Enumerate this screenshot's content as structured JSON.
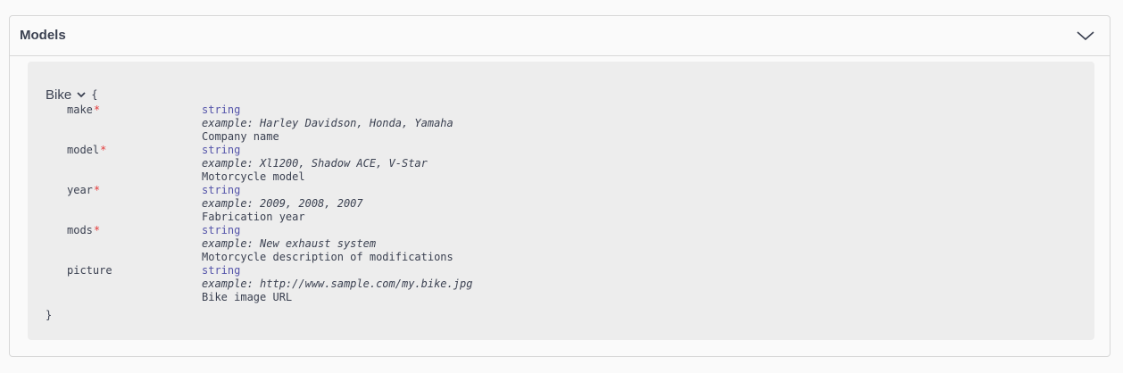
{
  "section": {
    "title": "Models",
    "toggle_icon": "chevron-down-icon"
  },
  "model": {
    "name": "Bike",
    "open_brace": "{",
    "close_brace": "}",
    "required_marker": "*",
    "properties": [
      {
        "name": "make",
        "required": true,
        "type": "string",
        "example": "example: Harley Davidson, Honda, Yamaha",
        "description": "Company name"
      },
      {
        "name": "model",
        "required": true,
        "type": "string",
        "example": "example: Xl1200, Shadow ACE, V-Star",
        "description": "Motorcycle model"
      },
      {
        "name": "year",
        "required": true,
        "type": "string",
        "example": "example: 2009, 2008, 2007",
        "description": "Fabrication year"
      },
      {
        "name": "mods",
        "required": true,
        "type": "string",
        "example": "example: New exhaust system",
        "description": "Motorcycle description of modifications"
      },
      {
        "name": "picture",
        "required": false,
        "type": "string",
        "example": "example: http://www.sample.com/my.bike.jpg",
        "description": "Bike image URL"
      }
    ]
  },
  "colors": {
    "type": "#5555aa",
    "required": "#e43b3b",
    "text": "#3b4151",
    "model_bg": "#ededed"
  }
}
